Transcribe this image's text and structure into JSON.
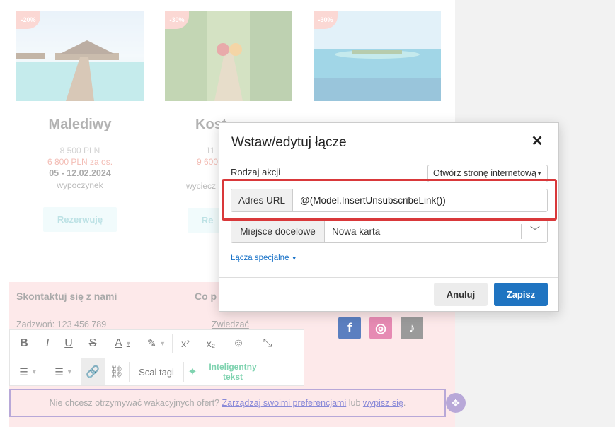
{
  "offers": [
    {
      "badge": "-20%",
      "title": "Malediwy",
      "old_price": "8 500 PLN",
      "new_price": "6 800 PLN za os.",
      "dates": "05 - 12.02.2024",
      "kind": "wypoczynek",
      "button": "Rezerwuję"
    },
    {
      "badge": "-30%",
      "title": "Kost",
      "old_price": "11",
      "new_price": "9 600",
      "dates": "",
      "kind": "wyciecz",
      "button": "Re"
    },
    {
      "badge": "-30%",
      "title": "",
      "old_price": "",
      "new_price": "",
      "dates": "",
      "kind": "",
      "button": ""
    }
  ],
  "contact": {
    "title": "Skontaktuj się z nami",
    "title2": "Co p",
    "phone": "Zadzwoń: 123 456 789",
    "visit": "Zwiedzać"
  },
  "toolbar": {
    "merge_tags": "Scal tagi",
    "smart_text": "Inteligentny tekst"
  },
  "unsubscribe": {
    "prefix": "Nie chcesz otrzymywać wakacyjnych ofert? ",
    "manage_link": "Zarządzaj swoimi preferencjami",
    "middle": " lub ",
    "unsub_link": "wypisz się",
    "suffix": "."
  },
  "modal": {
    "title": "Wstaw/edytuj łącze",
    "close": "✕",
    "action_label": "Rodzaj akcji",
    "action_value": "Otwórz stronę internetową",
    "url_label": "Adres URL",
    "url_value": "@(Model.InsertUnsubscribeLink())",
    "target_label": "Miejsce docelowe",
    "target_value": "Nowa karta",
    "special_links": "Łącza specjalne",
    "cancel": "Anuluj",
    "save": "Zapisz"
  },
  "colors": {
    "accent": "#1f74c1",
    "highlight": "#d9383a",
    "price": "#e46b5a"
  }
}
